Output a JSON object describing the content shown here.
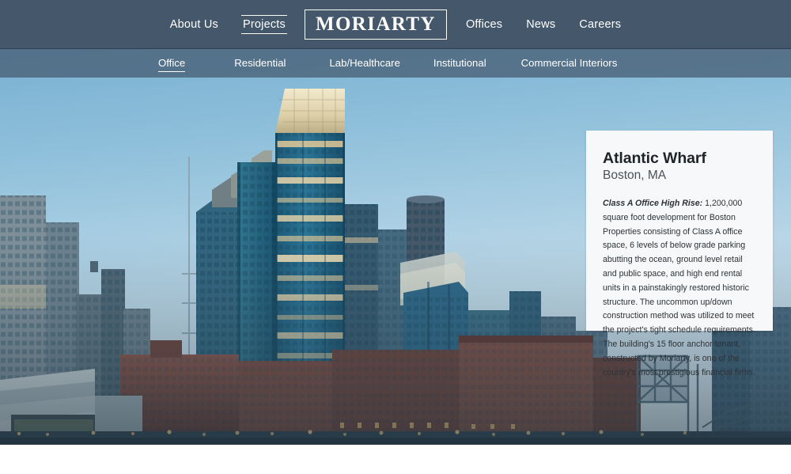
{
  "header": {
    "logo_text": "MORIARTY",
    "nav_left": [
      {
        "label": "About Us",
        "active": false
      },
      {
        "label": "Projects",
        "active": true
      }
    ],
    "nav_right": [
      {
        "label": "Offices",
        "active": false
      },
      {
        "label": "News",
        "active": false
      },
      {
        "label": "Careers",
        "active": false
      }
    ]
  },
  "subnav": {
    "items": [
      {
        "label": "Office",
        "active": true
      },
      {
        "label": "Residential",
        "active": false
      },
      {
        "label": "Lab/Healthcare",
        "active": false
      },
      {
        "label": "Institutional",
        "active": false
      },
      {
        "label": "Commercial Interiors",
        "active": false
      }
    ]
  },
  "project": {
    "title": "Atlantic Wharf",
    "location": "Boston, MA",
    "lead": "Class A Office High Rise:",
    "description": " 1,200,000 square foot development for Boston Properties consisting of Class A office space, 6 levels of below grade parking abutting the ocean, ground level retail and public space, and high end rental units in a painstakingly restored historic structure. The uncommon up/down construction method was utilized to meet the project's tight schedule requirements. The building's 15 floor anchor tenant, constructed by Moriarty, is one of the country's most prestigious financial firms."
  },
  "hero_image": {
    "alt": "Atlantic Wharf tower and Boston skyline at dusk",
    "sky_top": "#7fb4d4",
    "sky_bottom": "#cfe2ee",
    "tower_glass": "#2e6f8e",
    "tower_crown": "#e6ddc0",
    "brick": "#7d4b42",
    "window_light": "#f5c87a"
  },
  "colors": {
    "topbar": "#44576b",
    "subbar": "#4a6278",
    "card_bg": "#f7f8f9",
    "nav_text": "#ffffff"
  }
}
